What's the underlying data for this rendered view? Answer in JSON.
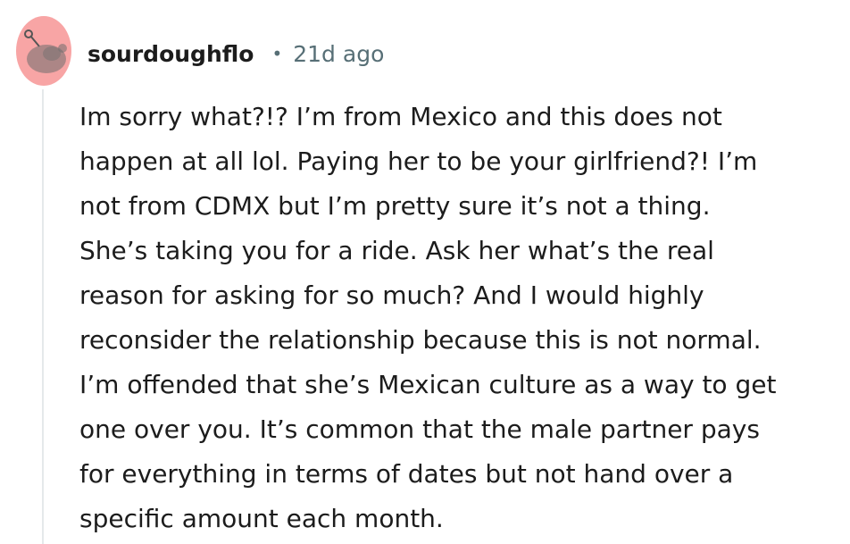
{
  "comment": {
    "username": "sourdoughflo",
    "separator": "•",
    "timestamp": "21d ago",
    "avatar_icon": "reddit-snoo-icon",
    "avatar_color": "#f8a5a5",
    "body": "Im sorry what?!? I’m from Mexico and this does not\nhappen at all lol. Paying her to be your girlfriend?! I’m\nnot from CDMX but I’m pretty sure it’s not a thing.\nShe’s taking you for a ride. Ask her what’s the real\nreason for asking for so much? And I would highly\nreconsider the relationship because this is not normal.\nI’m offended that she’s Mexican culture as a way to get\none over you. It’s common that the male partner pays\nfor everything in terms of dates but not hand over a\nspecific amount each month."
  }
}
